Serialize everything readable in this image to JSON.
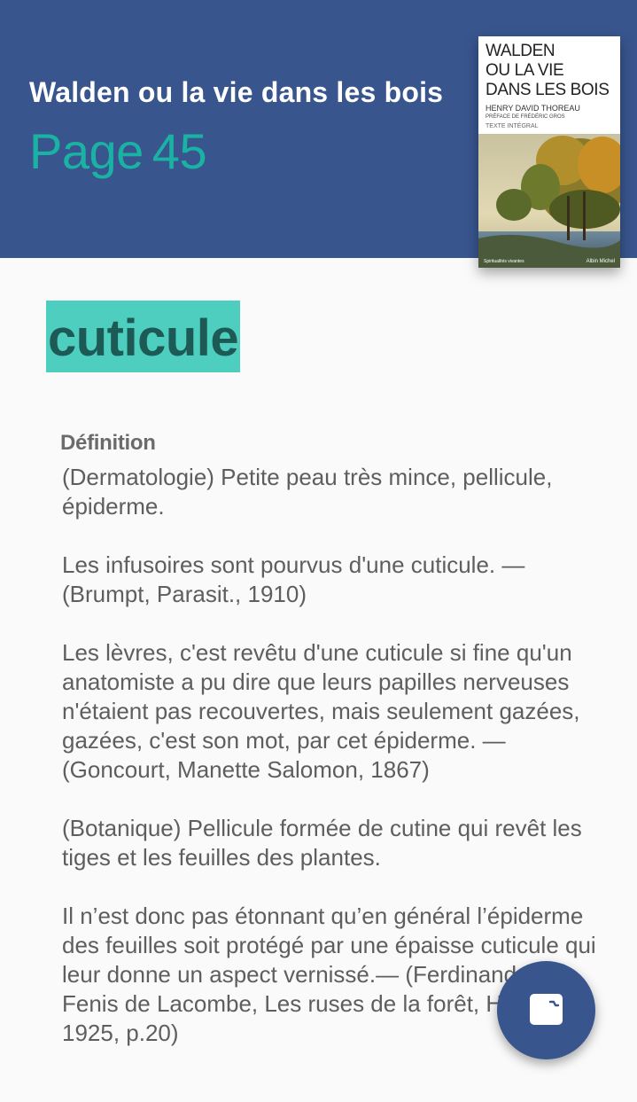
{
  "header": {
    "book_title": "Walden ou la vie dans les bois",
    "page_label": "Page",
    "page_number": "45"
  },
  "cover": {
    "title": "WALDEN\nOU LA VIE\nDANS LES BOIS",
    "author": "HENRY DAVID THOREAU",
    "preface": "PRÉFACE DE FRÉDÉRIC GROS",
    "edition": "TEXTE INTÉGRAL",
    "collection": "Spiritualités vivantes",
    "publisher": "Albin Michel"
  },
  "entry": {
    "word": "cuticule",
    "definition_label": "Définition",
    "paragraphs": [
      "(Dermatologie) Petite peau très mince, pellicule, épiderme.",
      "Les infusoires sont pourvus d'une cuticule. — (Brumpt, Parasit., 1910)",
      "Les lèvres, c'est revêtu d'une cuticule si fine qu'un anatomiste a pu dire que leurs papilles nerveuses n'étaient pas recouvertes, mais seulement gazées, gazées, c'est son mot, par cet épiderme. — (Goncourt, Manette Salomon, 1867)",
      "(Botanique) Pellicule formée de cutine qui revêt les tiges et les feuilles des plantes.",
      "Il n’est donc pas étonnant qu’en général l’épiderme des feuilles soit protégé par une épaisse cuticule qui leur donne un aspect vernissé.— (Ferdinand de Fenis de Lacombe, Les ruses de la forêt, Hanoi, 1925, p.20)"
    ]
  },
  "fab": {
    "icon": "notebook-icon"
  },
  "colors": {
    "header_bg": "#38558e",
    "page_accent": "#1ab3a3",
    "highlight": "#4dcebf",
    "highlight_text": "#1d5a55",
    "fab_bg": "#38558e"
  }
}
